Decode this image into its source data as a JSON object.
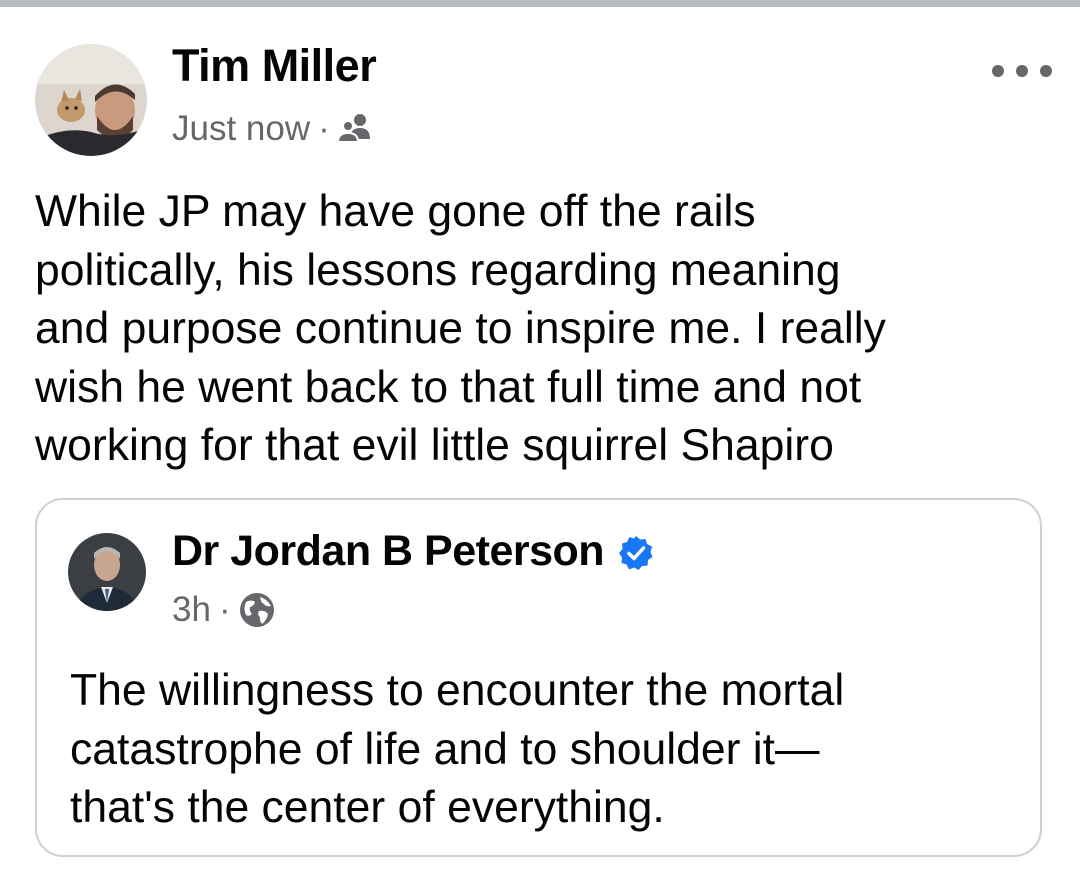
{
  "post": {
    "author": "Tim Miller",
    "time": "Just now",
    "separator": "·",
    "audience_icon": "friends-icon",
    "more_icon": "more-options-icon",
    "text": "While JP may have gone off the rails\npolitically, his lessons regarding meaning\nand purpose continue to inspire me. I really\nwish he went back to that full time and not\nworking for that evil little squirrel Shapiro"
  },
  "shared": {
    "author": "Dr Jordan B Peterson",
    "verified_icon": "verified-badge-icon",
    "time": "3h",
    "separator": "·",
    "audience_icon": "globe-icon",
    "text": "The willingness to encounter the mortal\ncatastrophe of life and to shoulder it—\nthat's the center of everything."
  },
  "colors": {
    "text": "#050505",
    "secondary_text": "#65676b",
    "verified": "#1877f2",
    "card_border": "#ced0d4",
    "top_bar": "#b8bcc2"
  }
}
